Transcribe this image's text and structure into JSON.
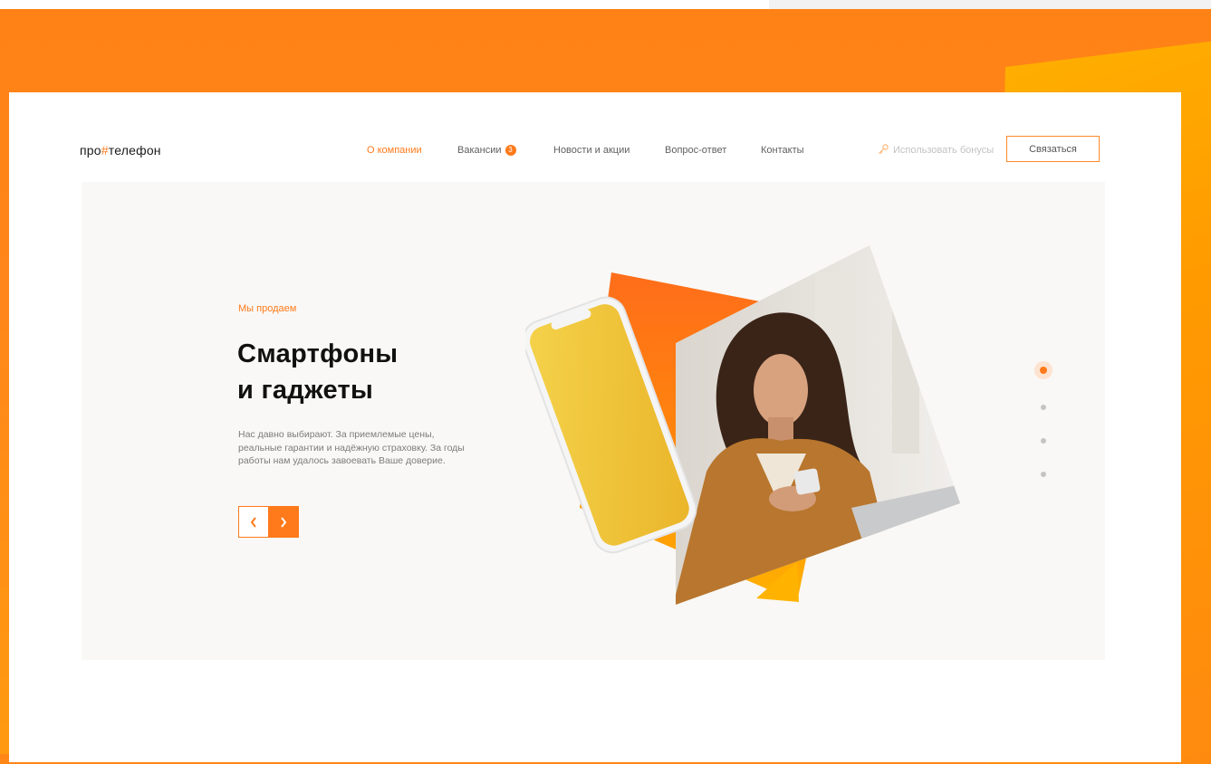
{
  "logo": {
    "prefix": "про",
    "hash": "#",
    "suffix": "телефон"
  },
  "nav": {
    "items": [
      {
        "label": "О компании",
        "active": true
      },
      {
        "label": "Вакансии",
        "badge": "3"
      },
      {
        "label": "Новости и акции"
      },
      {
        "label": "Вопрос-ответ"
      },
      {
        "label": "Контакты"
      }
    ]
  },
  "bonus": {
    "label": "Использовать бонусы",
    "icon": "key-icon"
  },
  "contact_button": {
    "label": "Связаться"
  },
  "hero": {
    "eyebrow": "Мы продаем",
    "headline": [
      "Смартфоны",
      "и гаджеты"
    ],
    "description": "Нас давно выбирают. За приемлемые цены, реальные гарантии и надёжную страховку. За годы работы нам удалось завоевать Ваше доверие.",
    "prev_icon": "chevron-left-icon",
    "next_icon": "chevron-right-icon"
  },
  "slider": {
    "total": 4,
    "active_index": 0
  },
  "colors": {
    "accent": "#ff7a1a",
    "background": "#ff8617",
    "hero_bg": "#f9f8f6",
    "phone_screen": "#f3c63c"
  }
}
